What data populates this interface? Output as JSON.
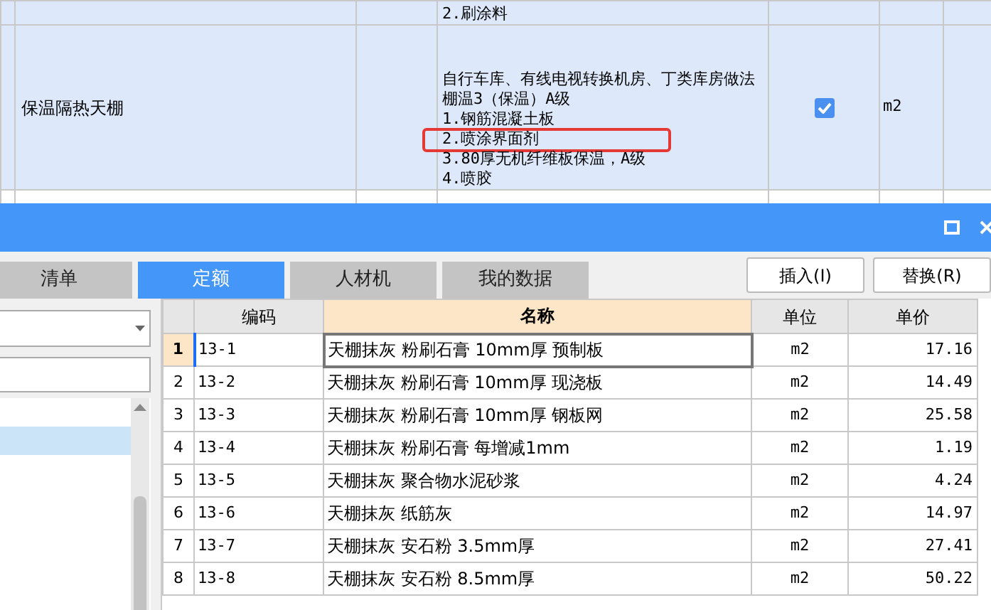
{
  "upper_table": {
    "rows": [
      {
        "name": "",
        "description": [
          {
            "text": "2.刷涂料",
            "highlighted": false
          }
        ],
        "checked": null,
        "unit": ""
      },
      {
        "name": "保温隔热天棚",
        "description": [
          {
            "text": "自行车库、有线电视转换机房、丁类库房做法",
            "highlighted": false
          },
          {
            "text": "棚温3（保温）A级",
            "highlighted": false
          },
          {
            "text": "1.钢筋混凝土板",
            "highlighted": false
          },
          {
            "text": "2.喷涂界面剂",
            "highlighted": true
          },
          {
            "text": "3.80厚无机纤维板保温，A级",
            "highlighted": false
          },
          {
            "text": "4.喷胶",
            "highlighted": false
          }
        ],
        "checked": true,
        "unit": "m2"
      }
    ]
  },
  "dialog": {
    "tabs": [
      {
        "label": "清单",
        "selected": false
      },
      {
        "label": "定额",
        "selected": true
      },
      {
        "label": "人材机",
        "selected": false
      },
      {
        "label": "我的数据",
        "selected": false
      }
    ],
    "buttons": [
      "插入(I)",
      "替换(R)"
    ],
    "table": {
      "columns": [
        "编码",
        "名称",
        "单位",
        "单价"
      ],
      "rows": [
        {
          "index": "1",
          "code": "13-1",
          "name": "天棚抹灰 粉刷石膏 10mm厚 预制板",
          "unit": "m2",
          "price": "17.16",
          "selected": true
        },
        {
          "index": "2",
          "code": "13-2",
          "name": "天棚抹灰 粉刷石膏 10mm厚 现浇板",
          "unit": "m2",
          "price": "14.49",
          "selected": false
        },
        {
          "index": "3",
          "code": "13-3",
          "name": "天棚抹灰 粉刷石膏 10mm厚 钢板网",
          "unit": "m2",
          "price": "25.58",
          "selected": false
        },
        {
          "index": "4",
          "code": "13-4",
          "name": "天棚抹灰 粉刷石膏 每增减1mm",
          "unit": "m2",
          "price": "1.19",
          "selected": false
        },
        {
          "index": "5",
          "code": "13-5",
          "name": "天棚抹灰 聚合物水泥砂浆",
          "unit": "m2",
          "price": "4.24",
          "selected": false
        },
        {
          "index": "6",
          "code": "13-6",
          "name": "天棚抹灰 纸筋灰",
          "unit": "m2",
          "price": "14.97",
          "selected": false
        },
        {
          "index": "7",
          "code": "13-7",
          "name": "天棚抹灰 安石粉 3.5mm厚",
          "unit": "m2",
          "price": "27.41",
          "selected": false
        },
        {
          "index": "8",
          "code": "13-8",
          "name": "天棚抹灰 安石粉 8.5mm厚",
          "unit": "m2",
          "price": "50.22",
          "selected": false
        }
      ]
    }
  }
}
